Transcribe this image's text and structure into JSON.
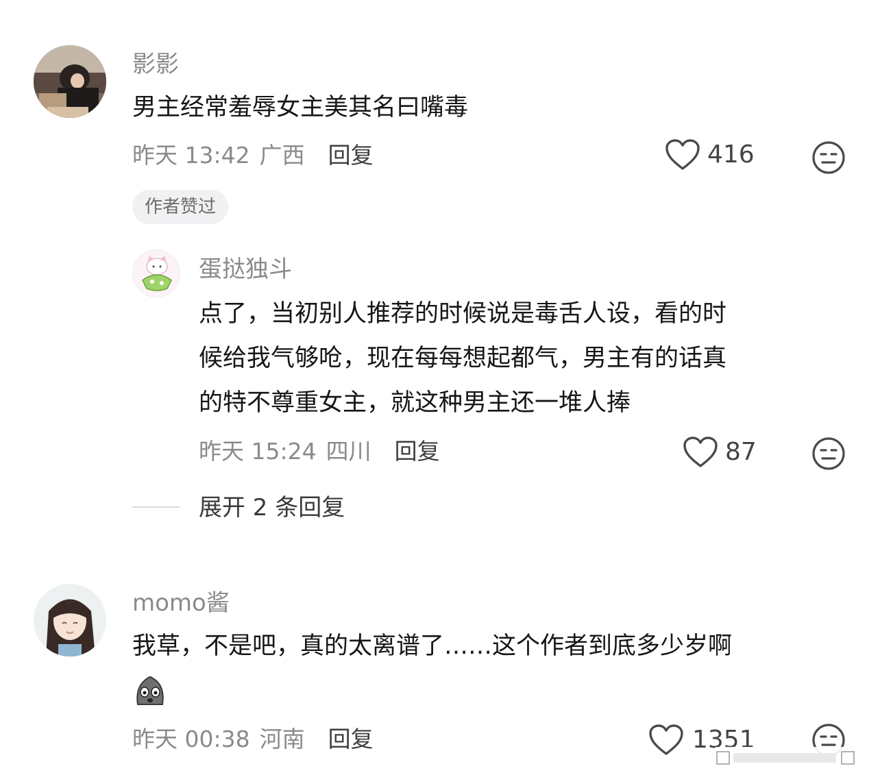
{
  "comments": [
    {
      "username": "影影",
      "text": "男主经常羞辱女主美其名曰嘴毒",
      "time": "昨天 13:42",
      "location": "广西",
      "reply_label": "回复",
      "likes": "416",
      "tag": "作者赞过",
      "replies": [
        {
          "username": "蛋挞独斗",
          "lines": [
            "点了，当初别人推荐的时候说是毒舌人设，看的时",
            "候给我气够呛，现在每每想起都气，男主有的话真",
            "的特不尊重女主，就这种男主还一堆人捧"
          ],
          "time": "昨天 15:24",
          "location": "四川",
          "reply_label": "回复",
          "likes": "87"
        }
      ],
      "expand_label": "展开 2 条回复"
    },
    {
      "username": "momo酱",
      "text": "我草，不是吧，真的太离谱了……这个作者到底多少岁啊",
      "time": "昨天 00:38",
      "location": "河南",
      "reply_label": "回复",
      "likes": "1351"
    }
  ],
  "icons": {
    "like": "heart-outline-icon",
    "dislike": "neutral-face-icon",
    "emoji": "sad-rock-emoji"
  },
  "colors": {
    "background": "#ffffff",
    "primary_text": "#161616",
    "secondary_text": "#8a8a8a",
    "tag_bg": "#f1f1f3"
  }
}
